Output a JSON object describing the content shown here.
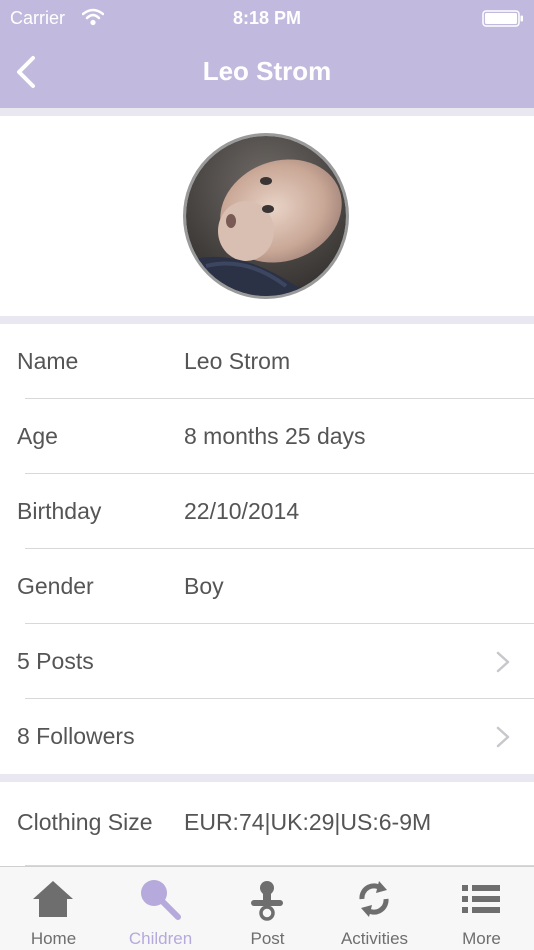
{
  "status": {
    "carrier": "Carrier",
    "time": "8:18 PM"
  },
  "nav": {
    "title": "Leo Strom"
  },
  "profile": {
    "rows": [
      {
        "label": "Name",
        "value": "Leo Strom"
      },
      {
        "label": "Age",
        "value": "8 months 25 days"
      },
      {
        "label": "Birthday",
        "value": "22/10/2014"
      },
      {
        "label": "Gender",
        "value": "Boy"
      }
    ],
    "posts": {
      "label": "5 Posts"
    },
    "followers": {
      "label": "8 Followers"
    },
    "clothing": {
      "label": "Clothing Size",
      "value": "EUR:74|UK:29|US:6-9M"
    }
  },
  "tabs": [
    {
      "label": "Home",
      "icon": "home-icon",
      "active": false
    },
    {
      "label": "Children",
      "icon": "rattle-icon",
      "active": true
    },
    {
      "label": "Post",
      "icon": "pacifier-icon",
      "active": false
    },
    {
      "label": "Activities",
      "icon": "refresh-icon",
      "active": false
    },
    {
      "label": "More",
      "icon": "list-icon",
      "active": false
    }
  ],
  "colors": {
    "header": "#c2bade",
    "accent": "#b6a9db",
    "section_gap": "#e9e7f0",
    "text": "#555555"
  }
}
